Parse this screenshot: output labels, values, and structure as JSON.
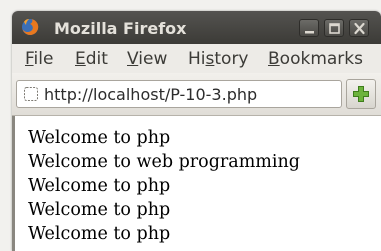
{
  "window": {
    "title": "Mozilla Firefox"
  },
  "menubar": {
    "items": [
      {
        "ul": "F",
        "rest": "ile"
      },
      {
        "ul": "E",
        "rest": "dit"
      },
      {
        "ul": "V",
        "rest": "iew"
      },
      {
        "pre": "Hi",
        "ul": "s",
        "rest": "tory"
      },
      {
        "ul": "B",
        "rest": "ookmarks"
      }
    ]
  },
  "navbar": {
    "url": "http://localhost/P-10-3.php",
    "icons": [
      "page-icon",
      "plus-icon"
    ]
  },
  "content": {
    "lines": [
      "Welcome to php",
      "Welcome to web programming",
      "Welcome to php",
      "Welcome to php",
      "Welcome to php"
    ]
  },
  "colors": {
    "titlebar": "#3c3b37",
    "title_text": "#e4e1da",
    "menubar": "#edebe7",
    "plus_icon": "#5aa02c"
  }
}
